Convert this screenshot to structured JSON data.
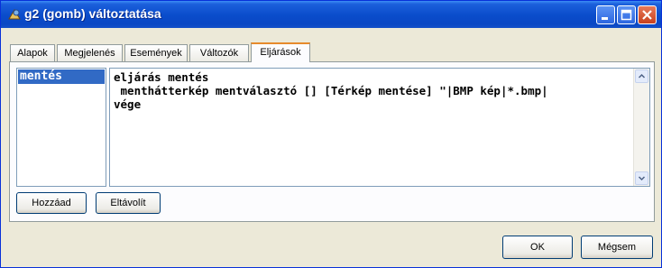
{
  "window": {
    "title": "g2 (gomb) változtatása",
    "controls": {
      "minimize_icon": "minimize-icon",
      "maximize_icon": "maximize-icon",
      "close_icon": "close-icon"
    }
  },
  "tabs": [
    {
      "label": "Alapok"
    },
    {
      "label": "Megjelenés"
    },
    {
      "label": "Események"
    },
    {
      "label": "Változók"
    },
    {
      "label": "Eljárások"
    }
  ],
  "active_tab": "Eljárások",
  "procedures": {
    "items": [
      "mentés"
    ],
    "selected": "mentés"
  },
  "editor": {
    "code": "eljárás mentés\n menthátterkép mentválasztó [] [Térkép mentése] \"|BMP kép|*.bmp|\nvége"
  },
  "buttons": {
    "add": "Hozzáad",
    "remove": "Eltávolít",
    "ok": "OK",
    "cancel": "Mégsem"
  },
  "colors": {
    "titlebar": "#0a4ccb",
    "selection": "#316ac5",
    "active_tab_accent": "#e68b2c"
  }
}
